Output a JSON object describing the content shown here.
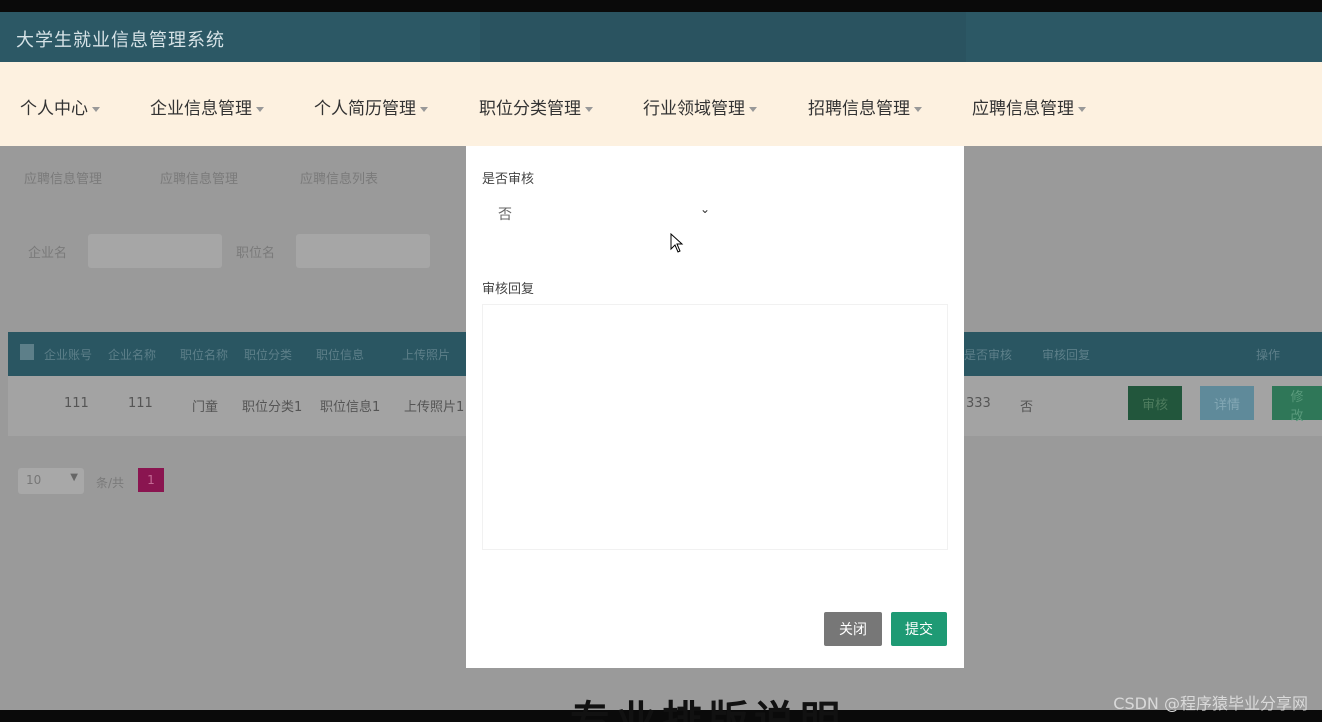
{
  "app": {
    "title": "大学生就业信息管理系统"
  },
  "nav": {
    "items": [
      {
        "label": "个人中心"
      },
      {
        "label": "企业信息管理"
      },
      {
        "label": "个人简历管理"
      },
      {
        "label": "职位分类管理"
      },
      {
        "label": "行业领域管理"
      },
      {
        "label": "招聘信息管理"
      },
      {
        "label": "应聘信息管理"
      }
    ]
  },
  "background": {
    "breadcrumb": [
      "应聘信息管理",
      "应聘信息管理",
      "应聘信息列表"
    ],
    "search_labels": [
      "企业名",
      "职位名"
    ],
    "table_headers": [
      "企业账号",
      "企业名称",
      "职位名称",
      "职位分类",
      "职位信息",
      "上传照片",
      "是否审核",
      "审核回复",
      "操作"
    ],
    "row": [
      "111",
      "111",
      "门童",
      "职位分类1",
      "职位信息1",
      "上传照片1",
      "333",
      "否"
    ],
    "row_buttons": [
      "审核",
      "详情",
      "修改"
    ],
    "pager_size": "10",
    "pager_total_label": "条/共",
    "pager_page": "1"
  },
  "modal": {
    "review_label": "是否审核",
    "review_value": "否",
    "reply_label": "审核回复",
    "reply_value": "",
    "close_label": "关闭",
    "submit_label": "提交"
  },
  "overlay": {
    "caption": "专业排版说明",
    "watermark": "CSDN @程序猿毕业分享网"
  }
}
